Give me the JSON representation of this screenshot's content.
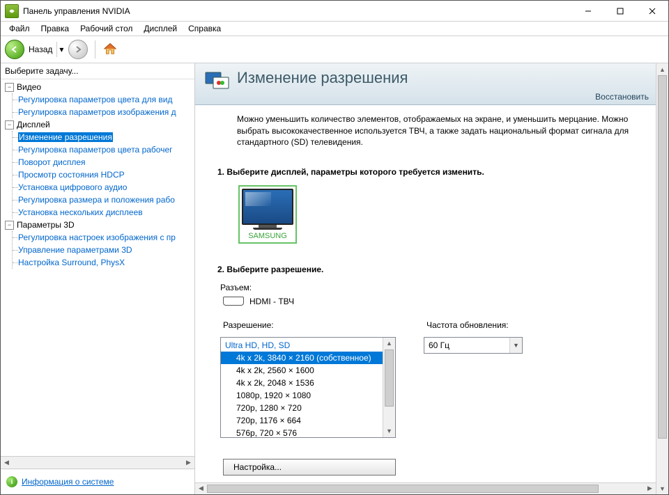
{
  "titlebar": {
    "title": "Панель управления NVIDIA"
  },
  "menu": {
    "file": "Файл",
    "edit": "Правка",
    "desktop": "Рабочий стол",
    "display": "Дисплей",
    "help": "Справка"
  },
  "toolbar": {
    "back": "Назад"
  },
  "sidebar": {
    "task_label": "Выберите задачу...",
    "video": {
      "label": "Видео",
      "items": [
        "Регулировка параметров цвета для вид",
        "Регулировка параметров изображения д"
      ]
    },
    "display": {
      "label": "Дисплей",
      "items": [
        "Изменение разрешения",
        "Регулировка параметров цвета рабочег",
        "Поворот дисплея",
        "Просмотр состояния HDCP",
        "Установка цифрового аудио",
        "Регулировка размера и положения рабо",
        "Установка нескольких дисплеев"
      ]
    },
    "params3d": {
      "label": "Параметры 3D",
      "items": [
        "Регулировка настроек изображения с пр",
        "Управление параметрами 3D",
        "Настройка Surround, PhysX"
      ]
    },
    "system_info": "Информация о системе"
  },
  "content": {
    "header": "Изменение разрешения",
    "restore": "Восстановить",
    "description": "Можно уменьшить количество элементов, отображаемых на экране, и уменьшить мерцание. Можно выбрать высококачественное используется ТВЧ, а также задать национальный формат сигнала для стандартного (SD) телевидения.",
    "step1_title": "1. Выберите дисплей, параметры которого требуется изменить.",
    "display_name": "SAMSUNG",
    "step2_title": "2. Выберите разрешение.",
    "connector_label": "Разъем:",
    "connector_value": "HDMI - ТВЧ",
    "resolution_label": "Разрешение:",
    "resolutions": {
      "group_label": "Ultra HD, HD, SD",
      "opts": [
        "4k x 2k, 3840 × 2160 (собственное)",
        "4k x 2k, 2560 × 1600",
        "4k x 2k, 2048 × 1536",
        "1080p, 1920 × 1080",
        "720p, 1280 × 720",
        "720p, 1176 × 664",
        "576p, 720 × 576"
      ]
    },
    "refresh_label": "Частота обновления:",
    "refresh_value": "60 Гц",
    "customize_btn": "Настройка..."
  }
}
